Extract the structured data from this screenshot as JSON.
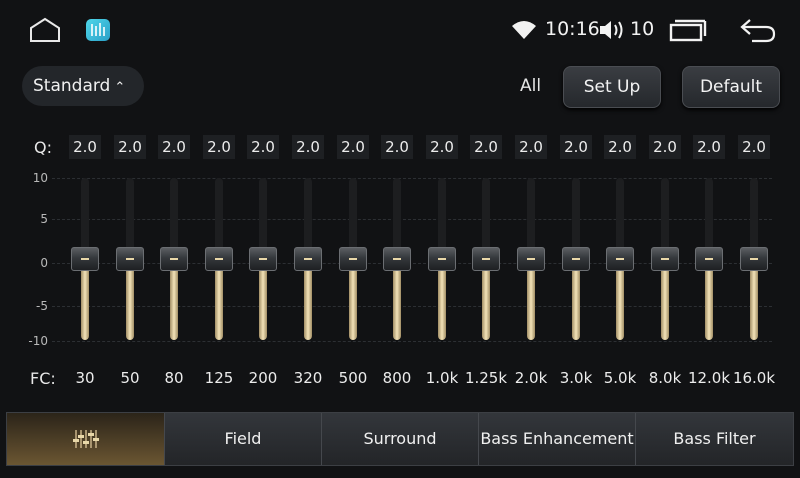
{
  "statusbar": {
    "time": "10:16",
    "volume": "10",
    "icons": [
      "home-icon",
      "equalizer-app-icon",
      "wifi-icon",
      "volume-icon",
      "recent-apps-icon",
      "back-icon"
    ]
  },
  "preset": {
    "label": "Standard",
    "caret": "^"
  },
  "controls": {
    "all_label": "All",
    "setup_label": "Set Up",
    "default_label": "Default"
  },
  "q": {
    "label": "Q:",
    "values": [
      "2.0",
      "2.0",
      "2.0",
      "2.0",
      "2.0",
      "2.0",
      "2.0",
      "2.0",
      "2.0",
      "2.0",
      "2.0",
      "2.0",
      "2.0",
      "2.0",
      "2.0",
      "2.0"
    ]
  },
  "scale": [
    "10",
    "5",
    "0",
    "-5",
    "-10"
  ],
  "bands": {
    "fc_label": "FC:",
    "frequencies": [
      "30",
      "50",
      "80",
      "125",
      "200",
      "320",
      "500",
      "800",
      "1.0k",
      "1.25k",
      "2.0k",
      "3.0k",
      "5.0k",
      "8.0k",
      "12.0k",
      "16.0k"
    ],
    "gains": [
      0,
      0,
      0,
      0,
      0,
      0,
      0,
      0,
      0,
      0,
      0,
      0,
      0,
      0,
      0,
      0
    ]
  },
  "tabs": [
    "",
    "Field",
    "Surround",
    "Bass Enhancement",
    "Bass Filter"
  ],
  "colors": {
    "accent_gold": "#e8d7a8",
    "background": "#111214"
  }
}
